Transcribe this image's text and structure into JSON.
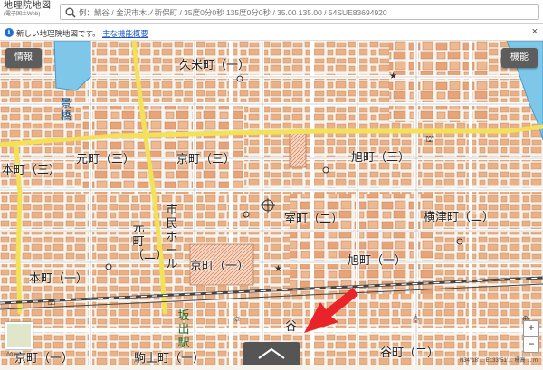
{
  "header": {
    "title_line1": "地理院地図",
    "title_line2": "(電子国土Web)",
    "search_placeholder": "例：鯖谷 / 金沢市木ノ新保町 / 35度0分0秒 135度0分0秒 / 35.00 135.00 / 54SUE83694920"
  },
  "notice": {
    "text": "新しい地理院地図です。",
    "link": "主な機能概要",
    "close": "×"
  },
  "map": {
    "info_button": "情報",
    "function_button": "機能",
    "zoom_in": "+",
    "zoom_out": "−",
    "labels": {
      "kume": "久米町（一）",
      "hon3": "本町（三）",
      "moto3": "元町（三）",
      "kyo3": "京町（三）",
      "asahi3": "旭町（三）",
      "muro2": "室町（二）",
      "yokotsu2": "横津町（二）",
      "kyo1_mid": "京町（一）",
      "asahi1": "旭町（一）",
      "hon1": "本町（一）",
      "kyo1_bottom": "京町（一）",
      "komagami": "駒上町（一）",
      "tani2": "谷町（二）",
      "tani": "谷",
      "keibashi": "景橋",
      "motomachi2_v": "元町（二）",
      "shimin_hall": "市民ホール",
      "sakade_station": "坂出駅"
    },
    "scale": "100 m",
    "coords": "N34°18'… E133°51'… 標高 ... m",
    "colors": {
      "main_road": "#f3e15a",
      "building": "#e9a87a",
      "river": "#7fc7e8",
      "railway": "#555555",
      "arrow": "#e8232a"
    }
  }
}
